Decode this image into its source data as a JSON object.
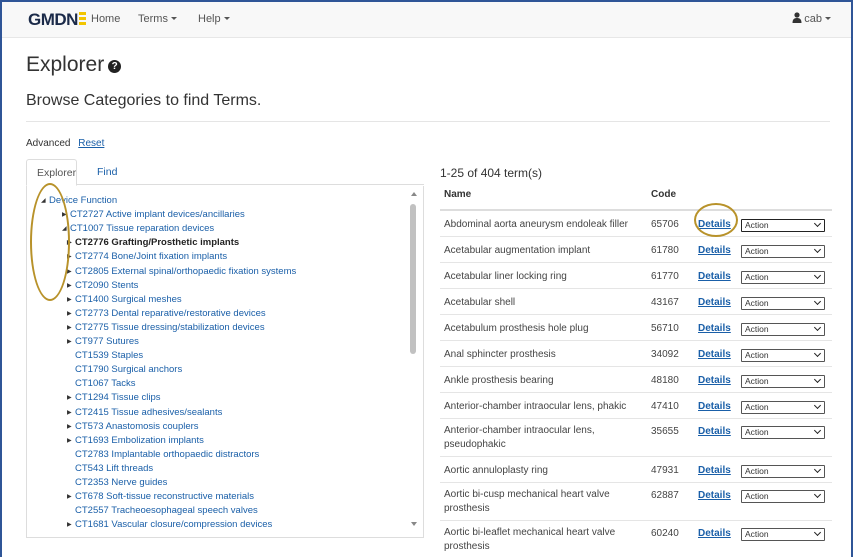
{
  "navbar": {
    "logo": "GMDN",
    "home": "Home",
    "terms": "Terms",
    "help": "Help",
    "user": "cab"
  },
  "header": {
    "title": "Explorer",
    "subtitle": "Browse Categories to find Terms."
  },
  "links": {
    "advanced": "Advanced",
    "reset": "Reset"
  },
  "tabs": [
    {
      "label": "Explorer",
      "active": true
    },
    {
      "label": "Find",
      "active": false
    }
  ],
  "tree": [
    {
      "label": "Device Function",
      "toggle": "expanded",
      "indent": 0,
      "bold": false
    },
    {
      "label": "CT2727 Active implant devices/ancillaries",
      "toggle": "collapsed",
      "indent": 1,
      "bold": false
    },
    {
      "label": "CT1007 Tissue reparation devices",
      "toggle": "expanded",
      "indent": 1,
      "bold": false
    },
    {
      "label": "CT2776 Grafting/Prosthetic implants",
      "toggle": "collapsed",
      "indent": 2,
      "bold": true
    },
    {
      "label": "CT2774 Bone/Joint fixation implants",
      "toggle": "collapsed",
      "indent": 2,
      "bold": false
    },
    {
      "label": "CT2805 External spinal/orthopaedic fixation systems",
      "toggle": "collapsed",
      "indent": 2,
      "bold": false
    },
    {
      "label": "CT2090 Stents",
      "toggle": "collapsed",
      "indent": 2,
      "bold": false
    },
    {
      "label": "CT1400 Surgical meshes",
      "toggle": "collapsed",
      "indent": 2,
      "bold": false
    },
    {
      "label": "CT2773 Dental reparative/restorative devices",
      "toggle": "collapsed",
      "indent": 2,
      "bold": false
    },
    {
      "label": "CT2775 Tissue dressing/stabilization devices",
      "toggle": "collapsed",
      "indent": 2,
      "bold": false
    },
    {
      "label": "CT977 Sutures",
      "toggle": "collapsed",
      "indent": 2,
      "bold": false
    },
    {
      "label": "CT1539 Staples",
      "toggle": "none",
      "indent": 2,
      "bold": false
    },
    {
      "label": "CT1790 Surgical anchors",
      "toggle": "none",
      "indent": 2,
      "bold": false
    },
    {
      "label": "CT1067 Tacks",
      "toggle": "none",
      "indent": 2,
      "bold": false
    },
    {
      "label": "CT1294 Tissue clips",
      "toggle": "collapsed",
      "indent": 2,
      "bold": false
    },
    {
      "label": "CT2415 Tissue adhesives/sealants",
      "toggle": "collapsed",
      "indent": 2,
      "bold": false
    },
    {
      "label": "CT573 Anastomosis couplers",
      "toggle": "collapsed",
      "indent": 2,
      "bold": false
    },
    {
      "label": "CT1693 Embolization implants",
      "toggle": "collapsed",
      "indent": 2,
      "bold": false
    },
    {
      "label": "CT2783 Implantable orthopaedic distractors",
      "toggle": "none",
      "indent": 2,
      "bold": false
    },
    {
      "label": "CT543 Lift threads",
      "toggle": "none",
      "indent": 2,
      "bold": false
    },
    {
      "label": "CT2353 Nerve guides",
      "toggle": "none",
      "indent": 2,
      "bold": false
    },
    {
      "label": "CT678 Soft-tissue reconstructive materials",
      "toggle": "collapsed",
      "indent": 2,
      "bold": false
    },
    {
      "label": "CT2557 Tracheoesophageal speech valves",
      "toggle": "none",
      "indent": 2,
      "bold": false
    },
    {
      "label": "CT1681 Vascular closure/compression devices",
      "toggle": "collapsed",
      "indent": 2,
      "bold": false
    }
  ],
  "results": {
    "count": "1-25 of 404 term(s)",
    "headers": {
      "name": "Name",
      "code": "Code"
    },
    "details_label": "Details",
    "action_label": "Action",
    "rows": [
      {
        "name": "Abdominal aorta aneurysm endoleak filler",
        "code": "65706",
        "lines": 1
      },
      {
        "name": "Acetabular augmentation implant",
        "code": "61780",
        "lines": 1
      },
      {
        "name": "Acetabular liner locking ring",
        "code": "61770",
        "lines": 1
      },
      {
        "name": "Acetabular shell",
        "code": "43167",
        "lines": 1
      },
      {
        "name": "Acetabulum prosthesis hole plug",
        "code": "56710",
        "lines": 1
      },
      {
        "name": "Anal sphincter prosthesis",
        "code": "34092",
        "lines": 1
      },
      {
        "name": "Ankle prosthesis bearing",
        "code": "48180",
        "lines": 1
      },
      {
        "name": "Anterior-chamber intraocular lens, phakic",
        "code": "47410",
        "lines": 1
      },
      {
        "name": "Anterior-chamber intraocular lens, pseudophakic",
        "code": "35655",
        "lines": 2
      },
      {
        "name": "Aortic annuloplasty ring",
        "code": "47931",
        "lines": 1
      },
      {
        "name": "Aortic bi-cusp mechanical heart valve prosthesis",
        "code": "62887",
        "lines": 2
      },
      {
        "name": "Aortic bi-leaflet mechanical heart valve prosthesis",
        "code": "60240",
        "lines": 2
      }
    ]
  },
  "colors": {
    "link": "#1a5fa8",
    "annotation": "#b8922a",
    "frame": "#2f5597"
  }
}
